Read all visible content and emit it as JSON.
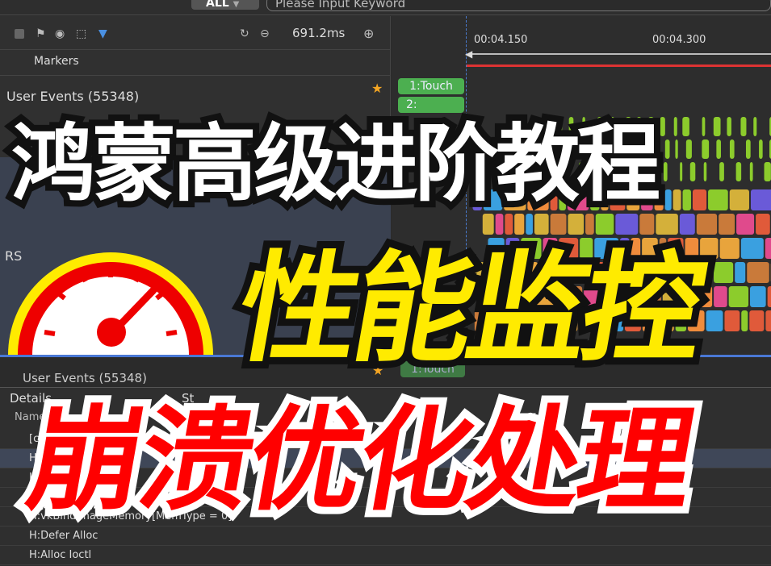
{
  "toolbar": {
    "filter_select": "ALL",
    "search_placeholder": "Please Input Keyword",
    "zoom_value": "691.2ms"
  },
  "left": {
    "markers": "Markers",
    "user_events": "User Events (55348)",
    "rs_label": "RS",
    "user_events_2": "User Events (55348)"
  },
  "timeline": {
    "ticks": [
      "00:04.150",
      "00:04.300"
    ],
    "touch_1": "1:Touch",
    "touch_2": "2:",
    "touch_3": "1:Touch"
  },
  "details": {
    "tab_details": "Details",
    "tab_other": "St",
    "column_name": "Name",
    "rows": [
      "[cou",
      "H:R",
      "H",
      "H:AllocAndBindImageMemory",
      "H:vkBindImageMemory[MemType = 0]",
      "H:Defer Alloc",
      "H:Alloc Ioctl"
    ]
  },
  "overlay": {
    "title": "鸿蒙高级进阶教程",
    "subtitle": "性能监控",
    "subtitle2": "崩溃优化处理"
  },
  "colors": {
    "accent": "#4a78d4",
    "touch": "#4caf50",
    "title_yellow": "#ffeb00",
    "title_red": "#ff0000",
    "flame": [
      "#e05a3a",
      "#f08c3c",
      "#e8a43c",
      "#d4b03a",
      "#8ccc2c",
      "#3aa0e0",
      "#6a5ad8",
      "#e04a8c",
      "#c97a3a"
    ]
  }
}
